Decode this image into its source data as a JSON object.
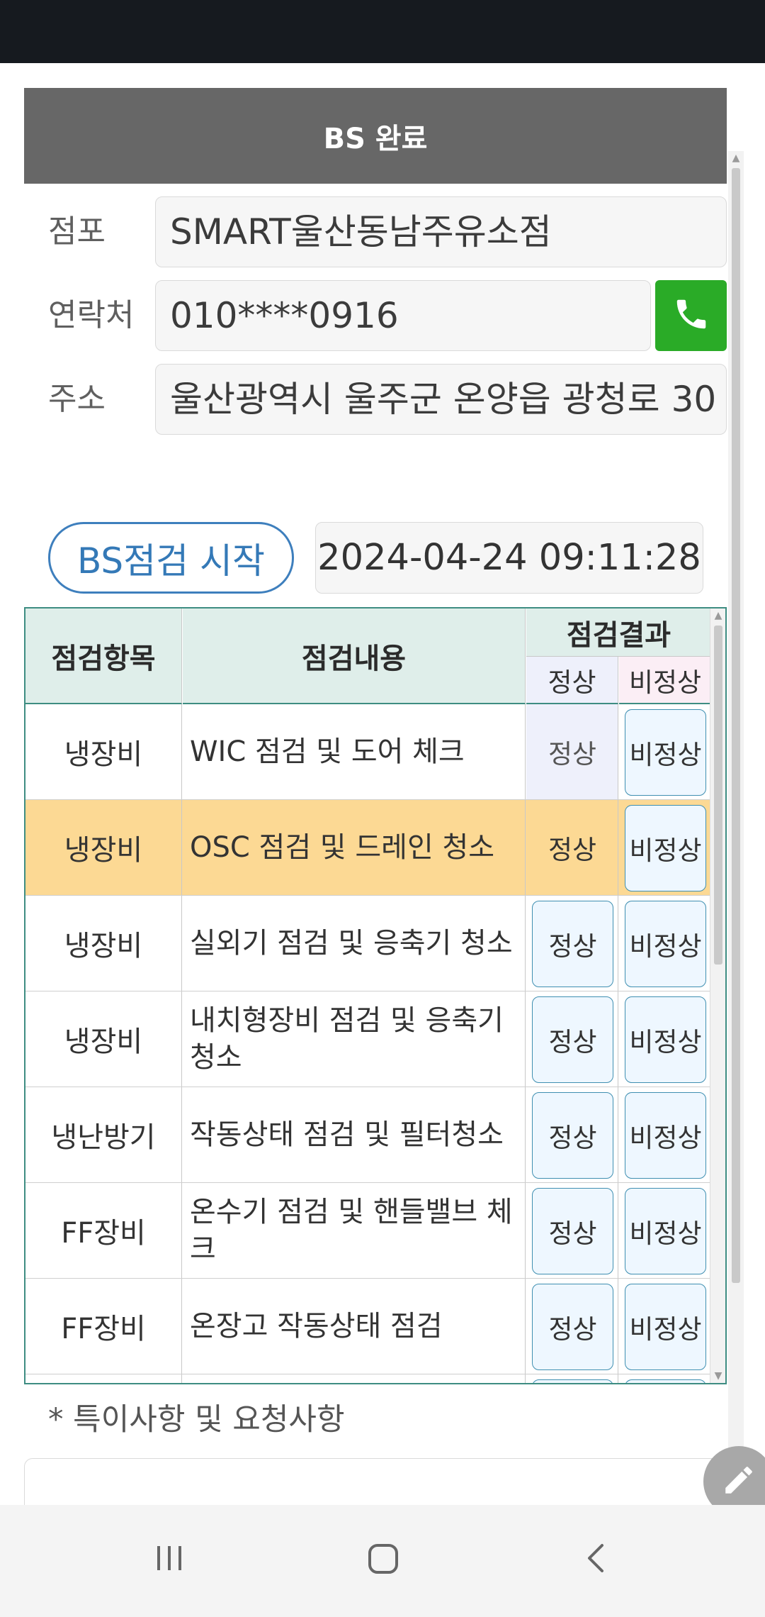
{
  "header": {
    "title": "BS 완료"
  },
  "fields": {
    "store": {
      "label": "점포",
      "value": "SMART울산동남주유소점"
    },
    "contact": {
      "label": "연락처",
      "value": "010****0916"
    },
    "address": {
      "label": "주소",
      "value": "울산광역시 울주군 온양읍 광청로 30"
    }
  },
  "inspection": {
    "start_label": "BS점검 시작",
    "datetime": "2024-04-24 09:11:28"
  },
  "table": {
    "col_item": "점검항목",
    "col_content": "점검내용",
    "col_result": "점검결과",
    "col_normal": "정상",
    "col_abnormal": "비정상",
    "rows": [
      {
        "category": "냉장비",
        "content": "WIC 점검 및 도어 체크",
        "normal": "정상",
        "abnormal": "비정상"
      },
      {
        "category": "냉장비",
        "content": "OSC 점검 및 드레인 청소",
        "normal": "정상",
        "abnormal": "비정상"
      },
      {
        "category": "냉장비",
        "content": "실외기 점검 및 응축기 청소",
        "normal": "정상",
        "abnormal": "비정상"
      },
      {
        "category": "냉장비",
        "content": "내치형장비 점검 및 응축기 청소",
        "normal": "정상",
        "abnormal": "비정상"
      },
      {
        "category": "냉난방기",
        "content": "작동상태 점검 및 필터청소",
        "normal": "정상",
        "abnormal": "비정상"
      },
      {
        "category": "FF장비",
        "content": "온수기 점검 및 핸들밸브 체크",
        "normal": "정상",
        "abnormal": "비정상"
      },
      {
        "category": "FF장비",
        "content": "온장고 작동상태 점검",
        "normal": "정상",
        "abnormal": "비정상"
      }
    ]
  },
  "notes": {
    "label": "* 특이사항 및 요청사항",
    "value": ""
  },
  "colors": {
    "header_bg": "#676767",
    "call_green": "#2aab27",
    "highlight_row": "#fcd994",
    "table_border": "#3e8d82",
    "accent_blue": "#3479b7"
  },
  "icons": {
    "call": "phone-icon",
    "edit": "pencil-icon"
  }
}
